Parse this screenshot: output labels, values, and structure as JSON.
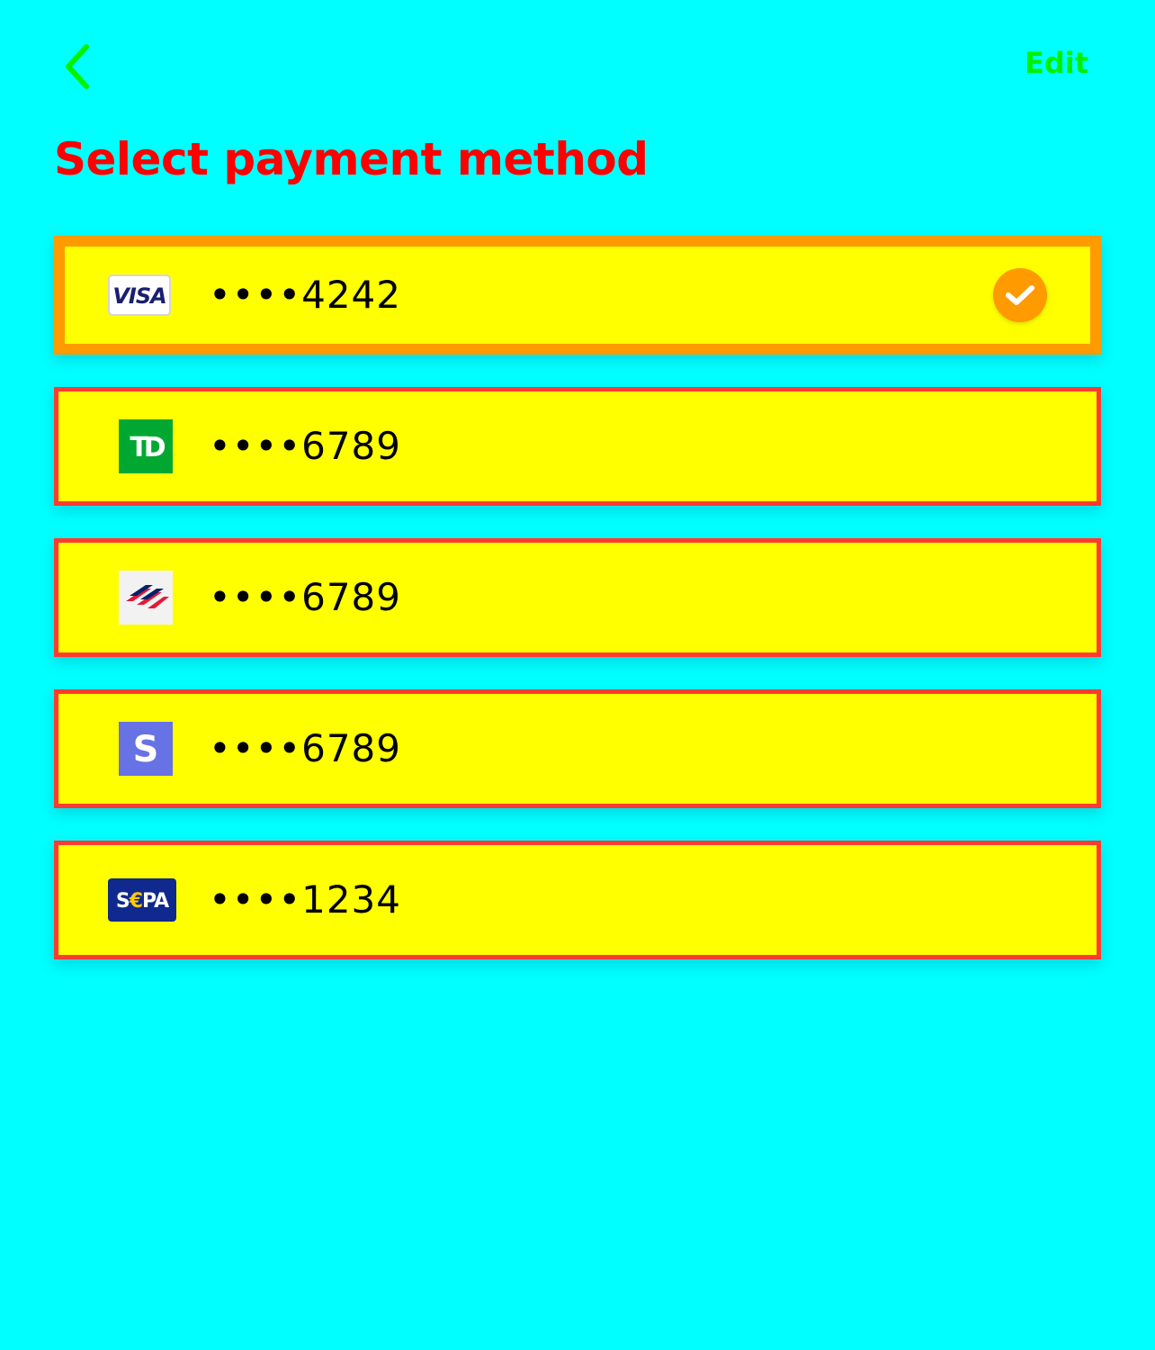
{
  "header": {
    "back_icon": "chevron-left-icon",
    "edit_label": "Edit",
    "accent_color": "#00F200"
  },
  "title": "Select payment method",
  "colors": {
    "background": "#00FFFF",
    "title": "#FF0000",
    "row_fill": "#FFFF00",
    "row_border": "#FF3B30",
    "selected_border": "#FF9A00"
  },
  "methods": [
    {
      "logo": "visa-logo",
      "number": "••••4242",
      "selected": true
    },
    {
      "logo": "td-bank-logo",
      "number": "••••6789",
      "selected": false
    },
    {
      "logo": "bank-of-america-logo",
      "number": "••••6789",
      "selected": false
    },
    {
      "logo": "stripe-logo",
      "number": "••••6789",
      "selected": false
    },
    {
      "logo": "sepa-logo",
      "number": "••••1234",
      "selected": false
    }
  ]
}
